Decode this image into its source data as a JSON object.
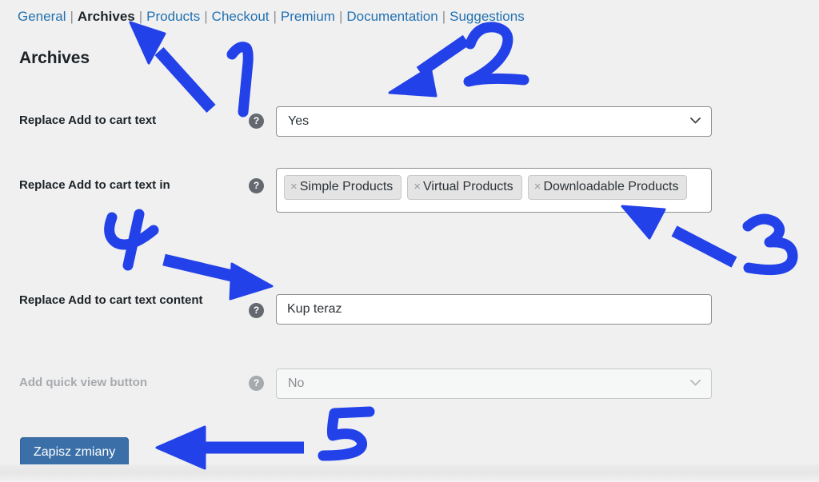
{
  "nav": {
    "separator": "|",
    "items": [
      {
        "label": "General",
        "current": false
      },
      {
        "label": "Archives",
        "current": true
      },
      {
        "label": "Products",
        "current": false
      },
      {
        "label": "Checkout",
        "current": false
      },
      {
        "label": "Premium",
        "current": false
      },
      {
        "label": "Documentation",
        "current": false
      },
      {
        "label": "Suggestions",
        "current": false
      }
    ]
  },
  "page_title": "Archives",
  "help_icon_glyph": "?",
  "help_icon_name": "help-icon",
  "chevron_icon_name": "chevron-down-icon",
  "rows": [
    {
      "label": "Replace Add to cart text",
      "control": "select",
      "value": "Yes",
      "disabled": false
    },
    {
      "label": "Replace Add to cart text in",
      "control": "multiselect",
      "tags": [
        {
          "label": "Simple Products",
          "remove": "×"
        },
        {
          "label": "Virtual Products",
          "remove": "×"
        },
        {
          "label": "Downloadable Products",
          "remove": "×"
        }
      ],
      "disabled": false
    },
    {
      "label": "Replace Add to cart text content",
      "control": "text",
      "value": "Kup teraz",
      "placeholder": "",
      "disabled": false
    },
    {
      "label": "Add quick view button",
      "control": "select",
      "value": "No",
      "disabled": true
    }
  ],
  "submit": {
    "label": "Zapisz zmiany"
  },
  "annotations": {
    "color": "#2341e8",
    "marks": [
      {
        "number": "1",
        "points_to": "archives-tab"
      },
      {
        "number": "2",
        "points_to": "replace-add-to-cart-text-select"
      },
      {
        "number": "3",
        "points_to": "replace-add-to-cart-text-in-multiselect"
      },
      {
        "number": "4",
        "points_to": "replace-add-to-cart-text-content-input"
      },
      {
        "number": "5",
        "points_to": "save-changes-button"
      }
    ]
  },
  "colors": {
    "background": "#f0f0f1",
    "link": "#2271b1",
    "text": "#1d2327",
    "disabled_text": "#a7aaad",
    "border": "#8c8f94",
    "tag_bg": "#e4e4e4",
    "button_bg": "#3a6fa8",
    "annotation_blue": "#2341e8"
  }
}
